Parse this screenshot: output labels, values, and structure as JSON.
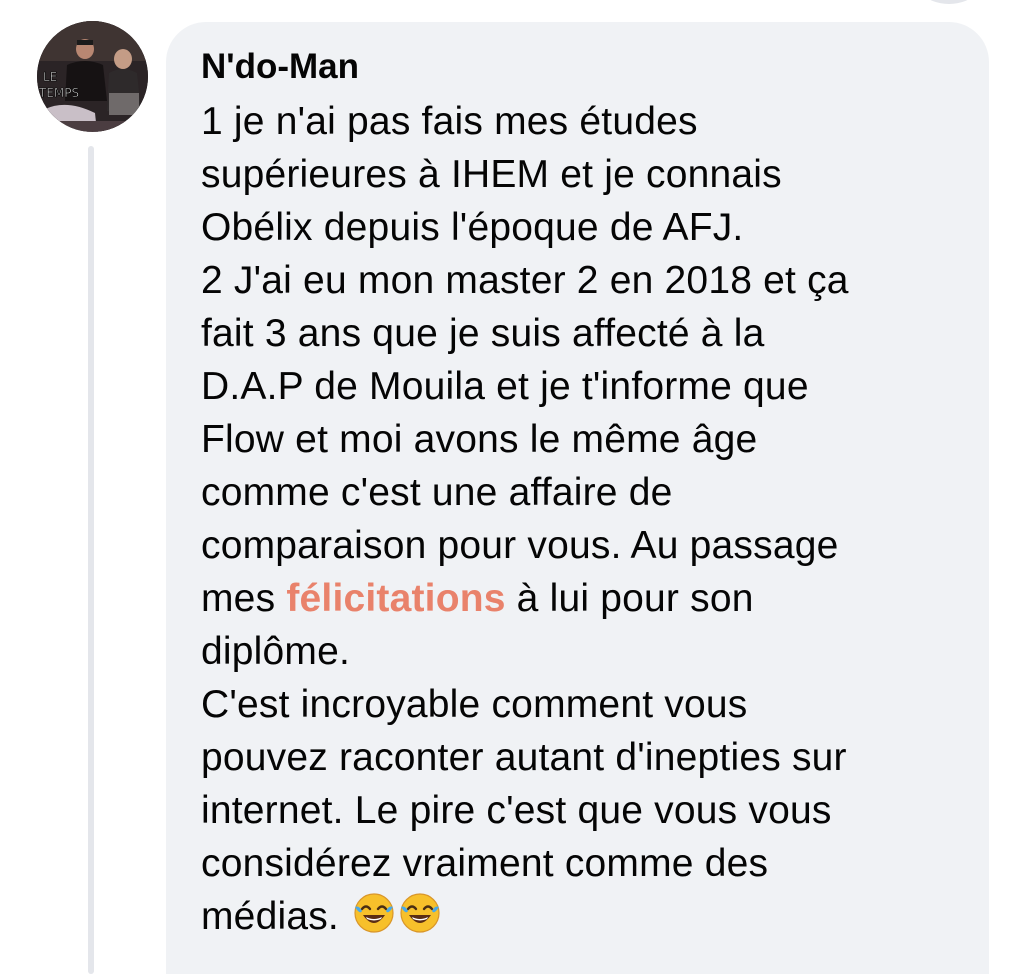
{
  "comment": {
    "author": "N'do-Man",
    "avatar_text": [
      "LE",
      "TEMPS"
    ],
    "lines": [
      [
        "1 je n'ai pas fais mes études"
      ],
      [
        "supérieures à IHEM et je connais"
      ],
      [
        "Obélix depuis l'époque de AFJ."
      ],
      [
        "2 J'ai eu mon master 2 en 2018 et ça"
      ],
      [
        "fait 3 ans que je suis affecté à la"
      ],
      [
        "D.A.P de Mouila et je t'informe que"
      ],
      [
        "Flow et moi avons le même âge"
      ],
      [
        "comme c'est une affaire de"
      ],
      [
        "comparaison pour vous. Au passage"
      ],
      [
        "mes ",
        "félicitations",
        " à lui pour son"
      ],
      [
        "diplôme."
      ],
      [
        "C'est incroyable comment vous"
      ],
      [
        "pouvez raconter autant d'inepties sur"
      ],
      [
        "internet.  Le pire c'est que vous vous"
      ],
      [
        "considérez vraiment comme des"
      ],
      [
        "médias. "
      ]
    ],
    "highlight_word": "félicitations",
    "highlight_color": "#e9826b",
    "trailing_emojis": [
      "face-with-tears-of-joy-icon",
      "face-with-tears-of-joy-icon"
    ]
  },
  "colors": {
    "bubble_bg": "#f0f2f5",
    "text": "#050505",
    "thread_line": "#e4e6eb"
  }
}
